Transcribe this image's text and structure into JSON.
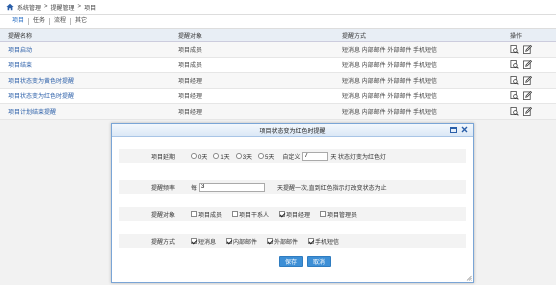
{
  "breadcrumb": {
    "items": [
      "系统管理",
      ">",
      "提醒管理",
      ">",
      "项目"
    ]
  },
  "tabs": [
    "项目",
    "任务",
    "流程",
    "其它"
  ],
  "table": {
    "headers": [
      "提醒名称",
      "提醒对象",
      "提醒方式",
      "操作"
    ],
    "rows": [
      {
        "name": "项目启动",
        "target": "项目成员",
        "method": "短消息 内部邮件 外部邮件 手机短信"
      },
      {
        "name": "项目结束",
        "target": "项目成员",
        "method": "短消息 内部邮件 外部邮件 手机短信"
      },
      {
        "name": "项目状态变为黄色时提醒",
        "target": "项目经理",
        "method": "短消息 内部邮件 外部邮件 手机短信"
      },
      {
        "name": "项目状态变为红色时提醒",
        "target": "项目经理",
        "method": "短消息 内部邮件 外部邮件 手机短信"
      },
      {
        "name": "项目计划结束提醒",
        "target": "项目经理",
        "method": "短消息 内部邮件 外部邮件 手机短信"
      }
    ]
  },
  "dialog": {
    "title": "项目状态变为红色时提醒",
    "deadline": {
      "label": "项目延期",
      "options": [
        "0天",
        "1天",
        "3天",
        "5天"
      ],
      "custom_label": "自定义",
      "custom_value": "7",
      "suffix": "天 状态灯变为红色灯"
    },
    "frequency": {
      "label": "提醒频率",
      "prefix": "每",
      "value": "3",
      "suffix": "天提醒一次,直到红色指示灯改变状态为止"
    },
    "targets": {
      "label": "提醒对象",
      "options": [
        {
          "label": "项目成员",
          "checked": false
        },
        {
          "label": "项目干系人",
          "checked": false
        },
        {
          "label": "项目经理",
          "checked": true
        },
        {
          "label": "项目管理员",
          "checked": false
        }
      ]
    },
    "methods": {
      "label": "提醒方式",
      "options": [
        {
          "label": "短消息",
          "checked": true
        },
        {
          "label": "内部邮件",
          "checked": true
        },
        {
          "label": "外部邮件",
          "checked": true
        },
        {
          "label": "手机短信",
          "checked": true
        }
      ]
    },
    "save_label": "保存",
    "cancel_label": "取消"
  },
  "colors": {
    "accent": "#2a5ea8",
    "button": "#3d8fd6",
    "header_bg": "#e8eef5"
  }
}
